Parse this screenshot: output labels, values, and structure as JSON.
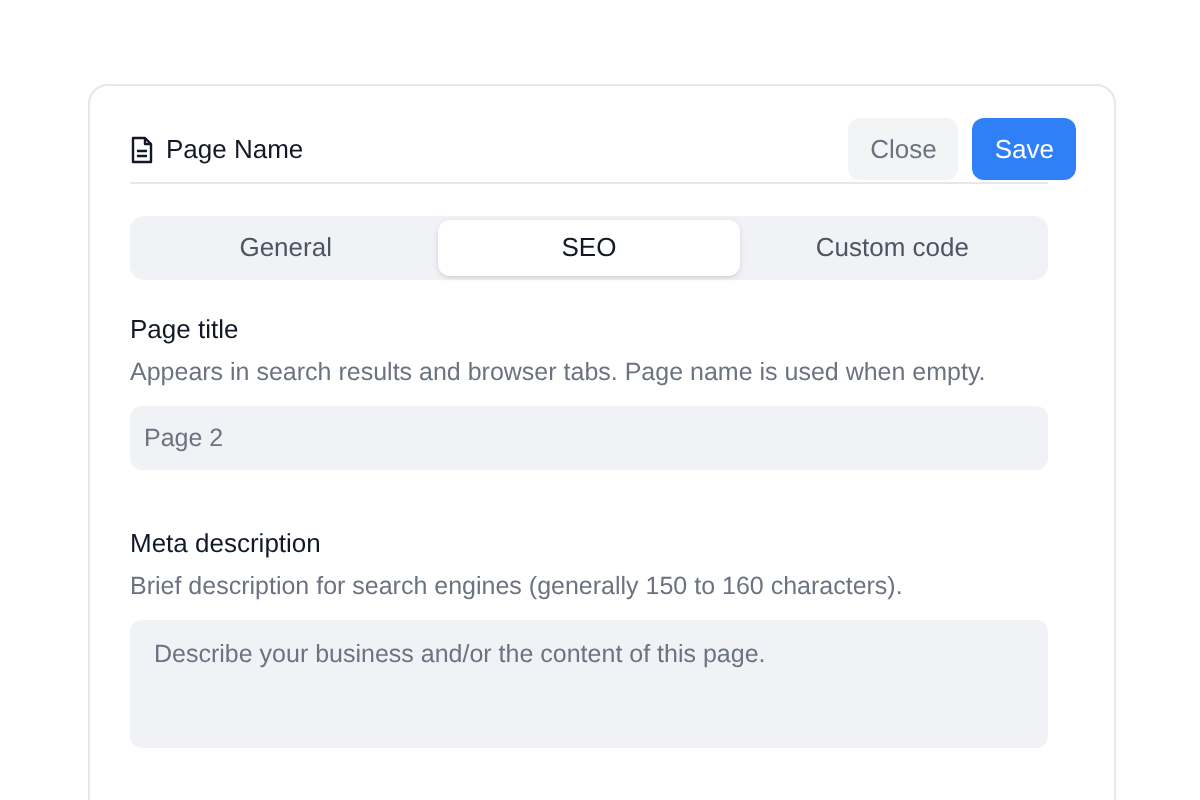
{
  "header": {
    "title": "Page Name",
    "buttons": [
      {
        "label": "Close",
        "kind": "secondary"
      },
      {
        "label": "Save",
        "kind": "primary"
      }
    ]
  },
  "tabs": [
    {
      "label": "General",
      "selected": false
    },
    {
      "label": "SEO",
      "selected": true
    },
    {
      "label": "Custom code",
      "selected": false
    }
  ],
  "fields": [
    {
      "label": "Page title",
      "help": "Appears in search results and browser tabs. Page name is used when empty.",
      "placeholder": "Page 2",
      "kind": "input"
    },
    {
      "label": "Meta description",
      "help": "Brief description for search engines (generally 150 to 160 characters).",
      "placeholder": "Describe your business and/or the content of this page.",
      "kind": "textarea"
    }
  ]
}
